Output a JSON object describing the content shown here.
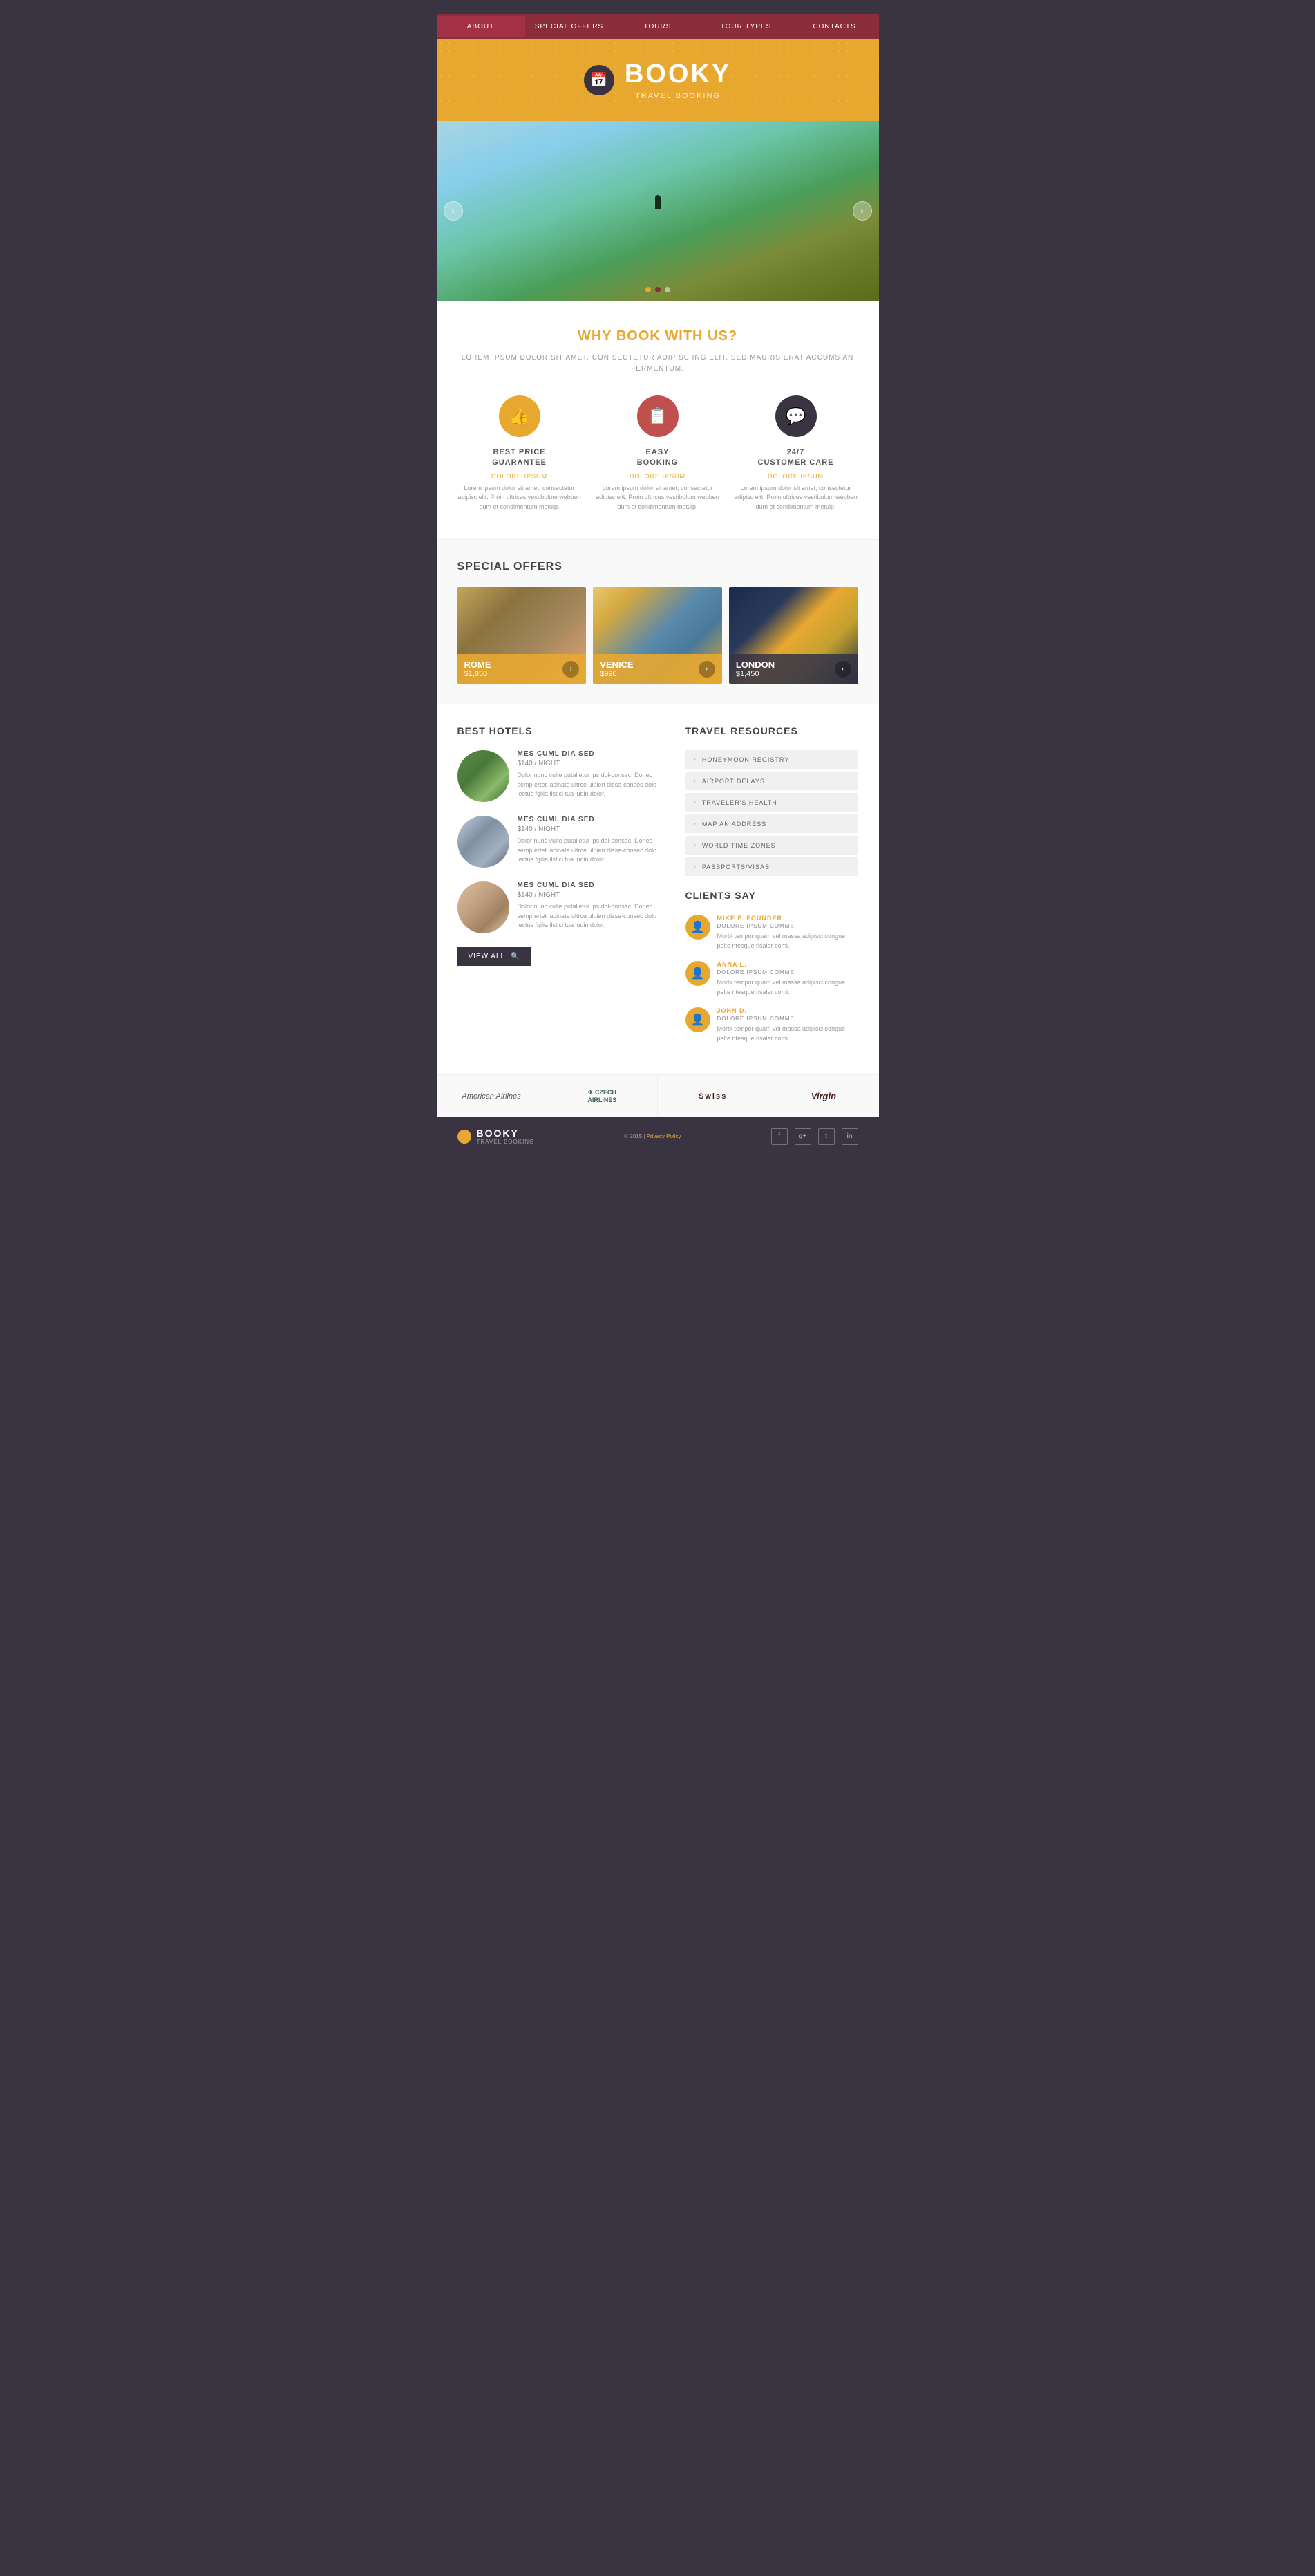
{
  "nav": {
    "items": [
      {
        "label": "ABOUT",
        "active": true
      },
      {
        "label": "SPECIAL OFFERS",
        "active": false
      },
      {
        "label": "TOURS",
        "active": false
      },
      {
        "label": "TOUR TYPES",
        "active": false
      },
      {
        "label": "CONTACTS",
        "active": false
      }
    ]
  },
  "header": {
    "icon": "📅",
    "title": "BOOKY",
    "subtitle": "TRAVEL BOOKING"
  },
  "hero": {
    "dots": [
      "active",
      "active2",
      ""
    ],
    "left_arrow": "‹",
    "right_arrow": "›"
  },
  "why_book": {
    "title": "WHY BOOK WITH US?",
    "subtitle": "LOREM IPSUM DOLOR SIT AMET, CON SECTETUR ADIPISC ING ELIT. SED MAURIS ERAT ACCUMS AN FERMENTUM.",
    "features": [
      {
        "icon": "👍",
        "icon_class": "gold",
        "name": "BEST PRICE\nGUARANTEE",
        "label": "DOLORE IPSUM",
        "text": "Lorem ipsum dolor sit amet, consectetur adipisc elit. Proin ultrices vestibulum webben dum et condimentum metuip."
      },
      {
        "icon": "📋",
        "icon_class": "red",
        "name": "EASY\nBOOKING",
        "label": "DOLORE IPSUM",
        "text": "Lorem ipsum dolor sit amet, consectetur adipisc elit. Proin ultrices vestibulum webben dum et condimentum metuip."
      },
      {
        "icon": "💬",
        "icon_class": "dark",
        "name": "24/7\nCUSTOMER CARE",
        "label": "DOLORE IPSUM",
        "text": "Lorem ipsum dolor sit amet, consectetur adipisc elit. Proin ultrices vestibulum webben dum et condimentum metuip."
      }
    ]
  },
  "special_offers": {
    "title": "SPECIAL OFFERS",
    "offers": [
      {
        "city": "ROME",
        "price": "$1,850",
        "img_class": "rome"
      },
      {
        "city": "VENICE",
        "price": "$990",
        "img_class": "venice"
      },
      {
        "city": "LONDON",
        "price": "$1,450",
        "img_class": "london",
        "dark": true
      }
    ]
  },
  "best_hotels": {
    "title": "BEST HOTELS",
    "hotels": [
      {
        "name": "MES CUML DIA SED",
        "price": "$140",
        "price_suffix": "/ NIGHT",
        "desc": "Dolor nunc vulte putalletur ips dol-consec. Donec semp ertet lacinate ultrce ulpien disse-consec dolo lectus fgilia ilstici tua ludin dolor.",
        "img_class": "img1"
      },
      {
        "name": "MES CUML DIA SED",
        "price": "$140",
        "price_suffix": "/ NIGHT",
        "desc": "Dolor nunc vulte putalletur ips dol-consec. Donec semp ertet lacinate ultrce ulpien disse-consec dolo lectus fgilia ilstici tua ludin dolor.",
        "img_class": "img2"
      },
      {
        "name": "MES CUML DIA SED",
        "price": "$140",
        "price_suffix": "/ NIGHT",
        "desc": "Dolor nunc vulte putalletur ips dol-consec. Donec semp ertet lacinate ultrce ulpien disse-consec dolo lectus fgilia ilstici tua ludin dolor.",
        "img_class": "img3"
      }
    ],
    "view_all": "VIEW ALL"
  },
  "travel_resources": {
    "title": "TRAVEL RESOURCES",
    "items": [
      "HONEYMOON REGISTRY",
      "AIRPORT DELAYS",
      "TRAVELER'S HEALTH",
      "MAP AN ADDRESS",
      "WORLD TIME ZONES",
      "PASSPORTS/VISAS"
    ]
  },
  "clients_say": {
    "title": "CLIENTS SAY",
    "clients": [
      {
        "name": "MIKE P. FOUNDER",
        "title": "DOLORE IPSUM COMME",
        "text": "Morbi tempor quam vel massa adipisci congue pelte ntesque risaler comi."
      },
      {
        "name": "ANNA L.",
        "title": "DOLORE IPSUM COMME",
        "text": "Morbi tempor quam vel massa adipisci congue pelte ntesque risaler comi."
      },
      {
        "name": "JOHN D.",
        "title": "DOLORE IPSUM COMME",
        "text": "Morbi tempor quam vel massa adipisci congue pelte ntesque risaler comi."
      }
    ]
  },
  "airlines": [
    {
      "name": "American Airlines",
      "logo": "American Airlines"
    },
    {
      "name": "Czech Airlines",
      "logo": "✈ CZECH\nAIRLINES"
    },
    {
      "name": "Swiss",
      "logo": "✚ SWISS"
    },
    {
      "name": "Virgin",
      "logo": "Virgin"
    }
  ],
  "footer": {
    "title": "BOOKY",
    "subtitle": "TRAVEL BOOKING",
    "copy": "© 2015 | Privacy Policy",
    "social": [
      "f",
      "g+",
      "t",
      "in"
    ]
  }
}
